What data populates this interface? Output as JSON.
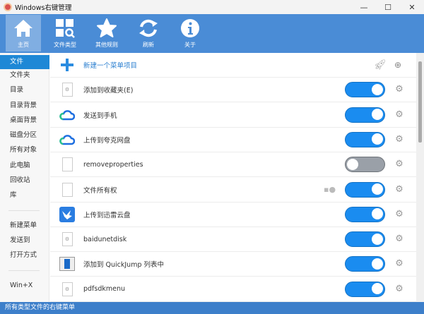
{
  "window": {
    "title": "Windows右键管理",
    "minimize": "—",
    "maximize": "☐",
    "close": "✕"
  },
  "toolbar": [
    {
      "label": "主页",
      "icon": "home-icon"
    },
    {
      "label": "文件类型",
      "icon": "file-types-icon"
    },
    {
      "label": "其他规则",
      "icon": "star-icon"
    },
    {
      "label": "刷新",
      "icon": "refresh-icon"
    },
    {
      "label": "关于",
      "icon": "info-icon"
    }
  ],
  "sidebar": {
    "groups": [
      [
        "文件",
        "文件夹",
        "目录",
        "目录背景",
        "桌面背景",
        "磁盘分区",
        "所有对象",
        "此电脑",
        "回收站",
        "库"
      ],
      [
        "新建菜单",
        "发送到",
        "打开方式"
      ],
      [
        "Win+X"
      ]
    ],
    "selected": "文件"
  },
  "main": {
    "new_item": "新建一个菜单项目",
    "items": [
      {
        "label": "添加到收藏夹(E)",
        "icon": "gear-doc-icon",
        "enabled": true
      },
      {
        "label": "发送到手机",
        "icon": "cloud-icon",
        "enabled": true
      },
      {
        "label": "上传到夸克网盘",
        "icon": "cloud-icon",
        "enabled": true
      },
      {
        "label": "removeproperties",
        "icon": "blank-doc-icon",
        "enabled": false
      },
      {
        "label": "文件所有权",
        "icon": "blank-doc-icon",
        "enabled": true
      },
      {
        "label": "上传到迅雷云盘",
        "icon": "xunlei-icon",
        "enabled": true
      },
      {
        "label": "baidunetdisk",
        "icon": "gear-doc-icon",
        "enabled": true
      },
      {
        "label": "添加到 QuickJump 列表中",
        "icon": "quickjump-icon",
        "enabled": true
      },
      {
        "label": "pdfsdkmenu",
        "icon": "gear-doc-icon",
        "enabled": true
      }
    ]
  },
  "status": "所有类型文件的右键菜单",
  "colors": {
    "toolbar": "#4a8cd6",
    "accent": "#1a8cf0",
    "status": "#3d7fca"
  }
}
